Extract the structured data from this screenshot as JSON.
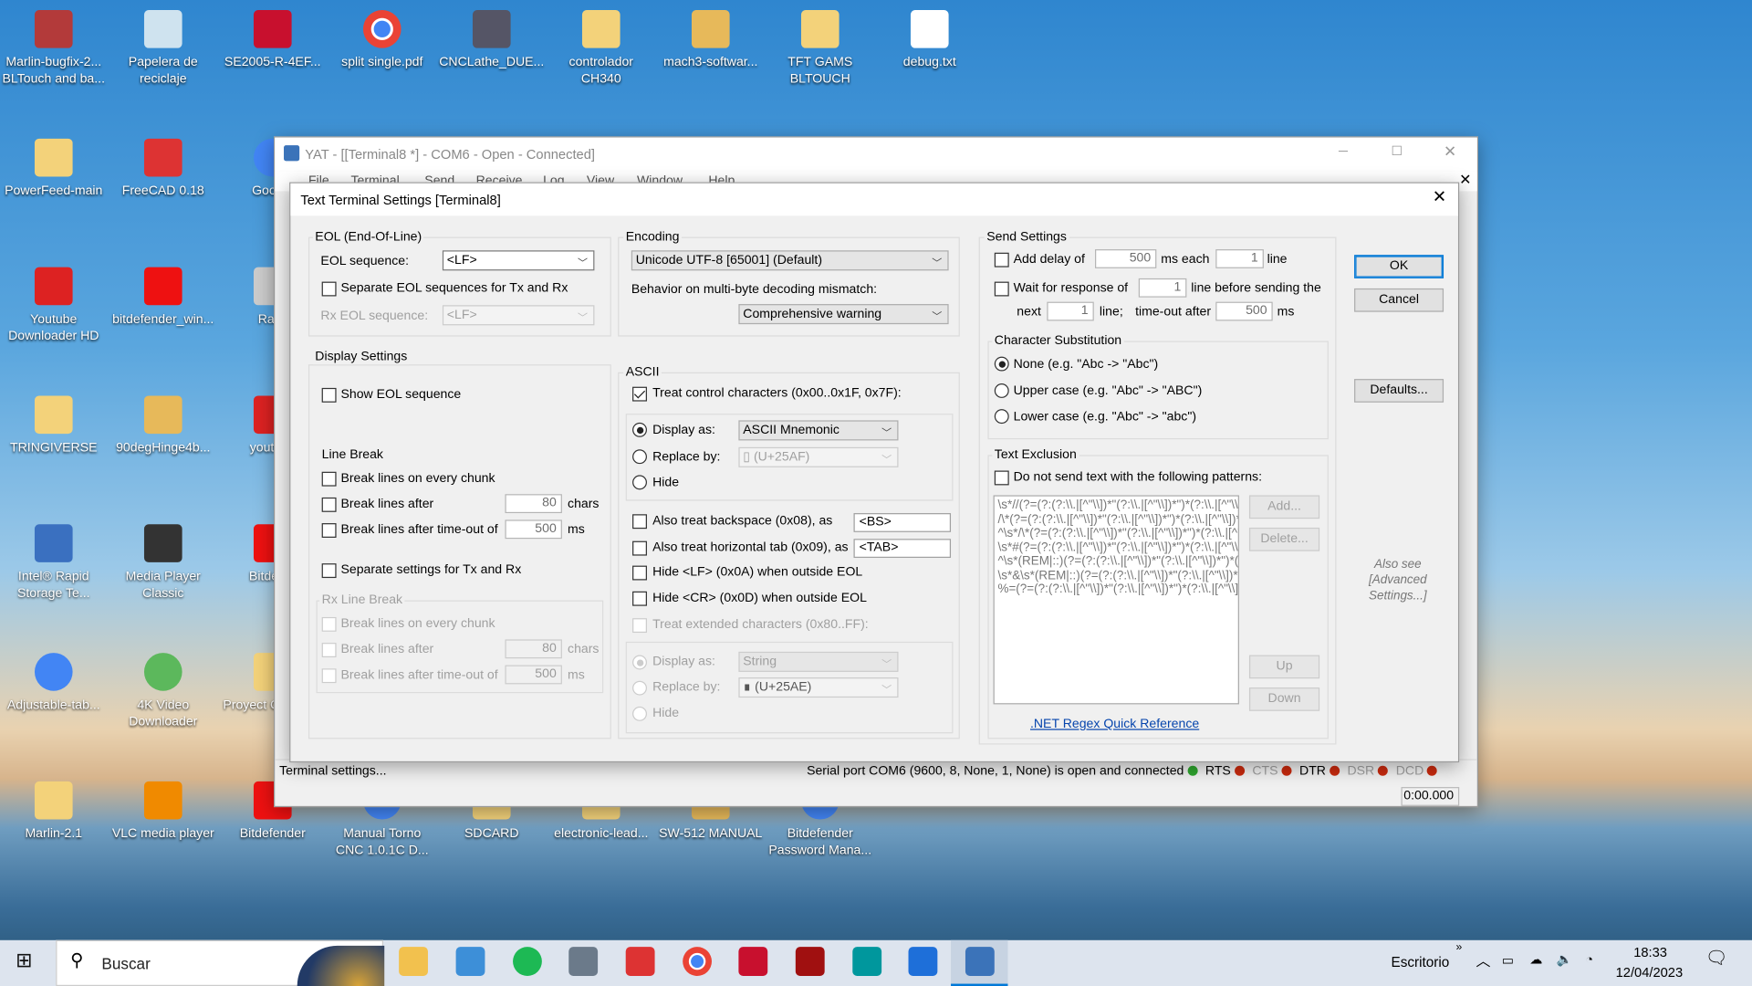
{
  "desktop": {
    "icons": [
      "Marlin-bugfix-2... BLTouch and ba...",
      "Papelera de reciclaje",
      "SE2005-R-4EF...",
      "split single.pdf",
      "CNCLathe_DUE...",
      "controlador CH340",
      "mach3-softwar...",
      "TFT GAMS BLTOUCH",
      "debug.txt",
      "PowerFeed-main",
      "FreeCAD 0.18",
      "Google",
      "Youtube Downloader HD",
      "bitdefender_win...",
      "RarE",
      "TRINGIVERSE",
      "90degHinge4b...",
      "youtube",
      "Intel® Rapid Storage Te...",
      "Media Player Classic",
      "Bitdefen",
      "Adjustable-tab...",
      "4K Video Downloader",
      "Proyect CNC con",
      "Marlin-2.1",
      "VLC media player",
      "Bitdefender",
      "Manual Torno CNC 1.0.1C D...",
      "SDCARD",
      "electronic-lead...",
      "SW-512 MANUAL",
      "Bitdefender Password Mana..."
    ]
  },
  "main_window": {
    "title": "YAT - [[Terminal8 *] - COM6 - Open - Connected]",
    "menu": [
      "File",
      "Terminal",
      "Send",
      "Receive",
      "Log",
      "View",
      "Window",
      "Help"
    ],
    "status_left": "Terminal settings...",
    "status_right": "Serial port COM6 (9600, 8, None, 1, None) is open and connected",
    "signals": [
      "RTS",
      "CTS",
      "DTR",
      "DSR",
      "DCD"
    ],
    "timer": "0:00.000",
    "colors": {
      "connected": "#2ea52e",
      "signal_off": "#c92a0e"
    }
  },
  "dialog": {
    "title": "Text Terminal Settings [Terminal8]",
    "eol": {
      "label": "EOL (End-Of-Line)",
      "seq_label": "EOL sequence:",
      "seq_value": "<LF>",
      "separate": "Separate EOL sequences for Tx and Rx",
      "rx_label": "Rx EOL sequence:",
      "rx_value": "<LF>"
    },
    "display": {
      "label": "Display Settings",
      "show_eol": "Show EOL sequence",
      "line_break": "Line Break",
      "every_chunk": "Break lines on every chunk",
      "after": "Break lines after",
      "after_value": "80",
      "chars": "chars",
      "timeout": "Break lines after time-out of",
      "timeout_value": "500",
      "ms": "ms",
      "separate": "Separate settings for Tx and Rx",
      "rx_line_break": "Rx Line Break",
      "rx_every_chunk": "Break lines on every chunk",
      "rx_after": "Break lines after",
      "rx_after_value": "80",
      "rx_chars": "chars",
      "rx_timeout": "Break lines after time-out of",
      "rx_timeout_value": "500",
      "rx_ms": "ms"
    },
    "encoding": {
      "label": "Encoding",
      "value": "Unicode UTF-8 [65001] (Default)",
      "mismatch_label": "Behavior on multi-byte decoding mismatch:",
      "mismatch_value": "Comprehensive warning"
    },
    "ascii": {
      "label": "ASCII",
      "treat_control": "Treat control characters (0x00..0x1F, 0x7F):",
      "display_as": "Display as:",
      "display_value": "ASCII Mnemonic",
      "replace_by": "Replace by:",
      "replace_value": "▯ (U+25AF)",
      "hide": "Hide",
      "backspace": "Also treat backspace (0x08), as",
      "backspace_value": "<BS>",
      "tab": "Also treat horizontal tab (0x09), as",
      "tab_value": "<TAB>",
      "hide_lf": "Hide <LF> (0x0A) when outside EOL",
      "hide_cr": "Hide <CR> (0x0D) when outside EOL",
      "treat_ext": "Treat extended characters (0x80..FF):",
      "ext_display_as": "Display as:",
      "ext_display_value": "String",
      "ext_replace_by": "Replace by:",
      "ext_replace_value": "∎ (U+25AE)",
      "ext_hide": "Hide"
    },
    "send": {
      "label": "Send Settings",
      "add_delay": "Add delay of",
      "delay_value": "500",
      "ms_each": "ms each",
      "line_value": "1",
      "line": "line",
      "wait": "Wait for response of",
      "wait_value": "1",
      "line_before": "line before sending the",
      "next": "next",
      "next_value": "1",
      "line_semi": "line;",
      "timeout_after": "time-out after",
      "timeout_value": "500",
      "ms": "ms",
      "char_sub": {
        "label": "Character Substitution",
        "options": [
          "None (e.g. \"Abc -> \"Abc\")",
          "Upper case (e.g. \"Abc\" -> \"ABC\")",
          "Lower case (e.g. \"Abc\" -> \"abc\")"
        ],
        "selected": 0
      },
      "exclusion": {
        "label": "Text Exclusion",
        "enable": "Do not send text with the following patterns:",
        "patterns": [
          "\\s*//(?=(?:(?:\\\\.|[^\"\\\\])*\"(?:\\\\.|[^\"\\\\])*\")*(?:\\\\.|[^\"\\\\])*$)",
          "/\\*(?=(?:(?:\\\\.|[^\"\\\\])*\"(?:\\\\.|[^\"\\\\])*\")*(?:\\\\.|[^\"\\\\])*$)",
          "^\\s*/\\*(?=(?:(?:\\\\.|[^\"\\\\])*\"(?:\\\\.|[^\"\\\\])*\")*(?:\\\\.|[^\"\\\\])*$)",
          "\\s*#(?=(?:(?:\\\\.|[^\"\\\\])*\"(?:\\\\.|[^\"\\\\])*\")*(?:\\\\.|[^\"\\\\])*$)",
          "^\\s*(REM|::)(?=(?:(?:\\\\.|[^\"\\\\])*\"(?:\\\\.|[^\"\\\\])*\")*(?:\\\\.|[^\"\\\\])*$)",
          "\\s*&\\s*(REM|::)(?=(?:(?:\\\\.|[^\"\\\\])*\"(?:\\\\.|[^\"\\\\])*\")*(?:\\\\.|[^\"\\\\])*$)",
          "%=(?=(?:(?:\\\\.|[^\"\\\\])*\"(?:\\\\.|[^\"\\\\])*\")*(?:\\\\.|[^\"\\\\])*$)"
        ],
        "add": "Add...",
        "delete": "Delete...",
        "up": "Up",
        "down": "Down",
        "link": ".NET Regex Quick Reference"
      }
    },
    "buttons": {
      "ok": "OK",
      "cancel": "Cancel",
      "defaults": "Defaults..."
    },
    "also_see": "Also see [Advanced Settings...]"
  },
  "taskbar": {
    "search": "Buscar",
    "desktop_label": "Escritorio",
    "time": "18:33",
    "date": "12/04/2023"
  }
}
